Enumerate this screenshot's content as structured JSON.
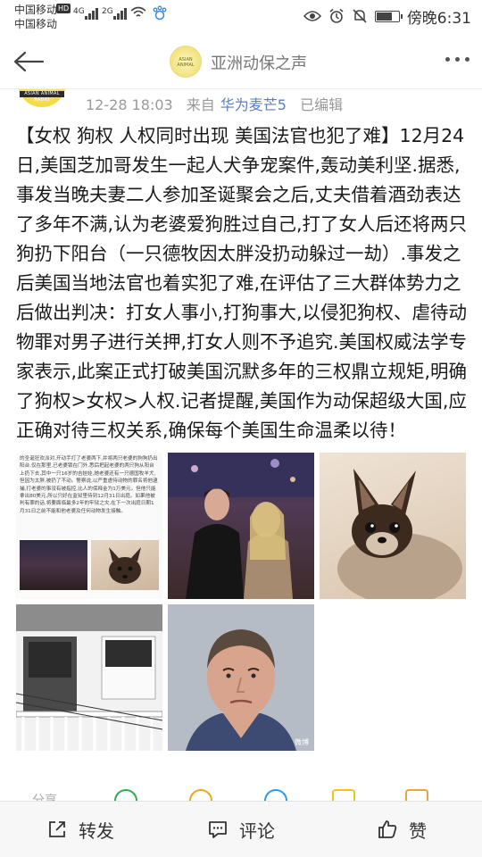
{
  "status_bar": {
    "carrier_1": "中国移动",
    "carrier_2": "中国移动",
    "hd": "HD",
    "net_1": "4G",
    "net_2": "2G",
    "time": "傍晚6:31",
    "battery_level": 0.75
  },
  "nav": {
    "account_name": "亚洲动保之声",
    "avatar_text": "ASIAN ANIMAL"
  },
  "post": {
    "avatar_band_text": "ASIAN ANIMAL RADIO",
    "date": "12-28 18:03",
    "from_label": "来自",
    "source": "华为麦芒5",
    "edited": "已编辑",
    "text": "【女权 狗权 人权同时出现 美国法官也犯了难】12月24日,美国芝加哥发生一起人犬争宠案件,轰动美利坚.据悉,事发当晚夫妻二人参加圣诞聚会之后,丈夫借着酒劲表达了多年不满,认为老婆爱狗胜过自己,打了女人后还将两只狗扔下阳台（一只德牧因太胖没扔动躲过一劫）.事发之后美国当地法官也着实犯了难,在评估了三大群体势力之后做出判决：打女人事小,打狗事大,以侵犯狗权、虐待动物罪对男子进行关押,打女人则不予追究.美国权威法学专家表示,此案正式打破美国沉默多年的三权鼎立规矩,明确了狗权>女权>人权.记者提醒,美国作为动保超级大国,应正确对待三权关系,确保每个美国生命温柔以待！"
  },
  "images": {
    "tile1_text": "的圣诞狂欢派对,开动手打了老婆两下,并将两只老婆的狗狗扔出阳台,仅在那里,已老婆锁在门外,悉后把起老婆的两只狗从阳台上扔下去,其中一只16岁的吉娃娃,她老婆还有一只德国牧羊犬,但因为太胖,被扔了不动。警察说,以严重虐待动物的罪名将他逮捕,打老婆的事没有被指控,比人的保释金为1万美元。但他只能拿出80美元,所以只好在监狱里待到12月31日出庭。如果他被判有罪的话,将要面临最多2年的牢狱之灾,在下一次出庭日期1月31日之前不能和他老婆及任何动物发生接触。",
    "watermark": "微博"
  },
  "reactions": {
    "share_label": "分享"
  },
  "actions": {
    "repost": "转发",
    "comment": "评论",
    "like": "赞"
  }
}
